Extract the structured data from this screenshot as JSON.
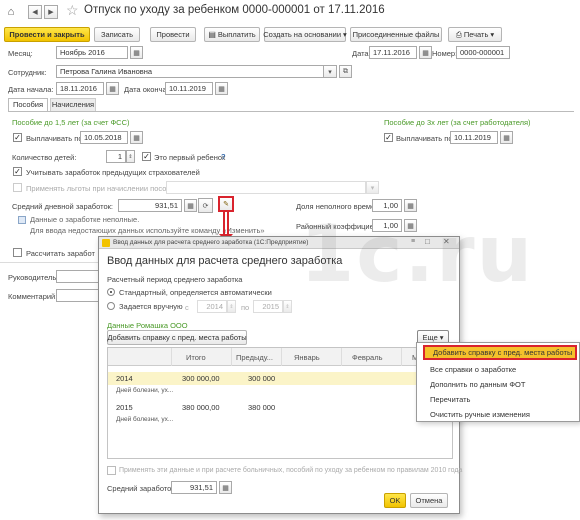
{
  "window": {
    "title": "Отпуск по уходу за ребенком 0000-000001 от 17.11.2016"
  },
  "toolbar": {
    "post_close": "Провести и закрыть",
    "save": "Записать",
    "post": "Провести",
    "pay": "Выплатить",
    "create_based": "Создать на основании",
    "attached_files": "Присоединенные файлы",
    "print": "Печать"
  },
  "header": {
    "month_label": "Месяц:",
    "month_value": "Ноябрь 2016",
    "date_label": "Дата:",
    "date_value": "17.11.2016",
    "number_label": "Номер:",
    "number_value": "0000-000001",
    "employee_label": "Сотрудник:",
    "employee_value": "Петрова Галина Ивановна",
    "start_label": "Дата начала:",
    "start_value": "18.11.2016",
    "end_label": "Дата окончания:",
    "end_value": "10.11.2019"
  },
  "tabs": [
    "Пособия",
    "Начисления"
  ],
  "benefits": {
    "under15_title": "Пособие до 1,5 лет (за счет ФСС)",
    "under3_title": "Пособие до 3х лет (за счет работодателя)",
    "pay_until_label": "Выплачивать по",
    "pay_until_value": "10.05.2018",
    "pay_until3_label": "Выплачивать по",
    "pay_until3_value": "10.11.2019",
    "children_label": "Количество детей:",
    "children_value": "1",
    "first_child_label": "Это первый ребенок",
    "first_child_help": "?",
    "prev_insurers_label": "Учитывать заработок предыдущих страхователей",
    "privileges_label": "Применять льготы при начислении пособия",
    "avg_earnings_label": "Средний дневной заработок:",
    "avg_earnings_value": "931,51",
    "parttime_label": "Доля неполного времени:",
    "parttime_value": "1,00",
    "regional_label": "Районный коэффициент:",
    "regional_value": "1,00",
    "warning_line1": "Данные о заработке неполные.",
    "warning_line2": "Для ввода недостающих данных используйте команду «Изменить»",
    "calc_leave_label": "Рассчитать заработ",
    "manager_label": "Руководитель:",
    "comment_label": "Комментарий:"
  },
  "dialog": {
    "window_title": "Ввод данных для расчета среднего заработка  (1С:Предприятие)",
    "heading": "Ввод данных для расчета среднего заработка",
    "period_label": "Расчетный период среднего заработка",
    "standard_label": "Стандартный, определяется автоматически",
    "manual_label": "Задается вручную",
    "from_label": "с",
    "from_value": "2014",
    "to_label": "по",
    "to_value": "2015",
    "company_label": "Данные Ромашка ООО",
    "add_certificate": "Добавить справку с пред. места работы",
    "more": "Еще",
    "columns": [
      "",
      "Итого",
      "Предыду...",
      "Январь",
      "Февраль",
      "Ма"
    ],
    "rows": [
      {
        "year": "2014",
        "total": "300 000,00",
        "prev": "300 000",
        "sub": "Дней болезни, ух..."
      },
      {
        "year": "2015",
        "total": "380 000,00",
        "prev": "380 000",
        "sub": "Дней болезни, ух..."
      }
    ],
    "apply_label": "Применять эти данные и при расчете больничных, пособий по уходу за ребенком по правилам 2010 года",
    "avg_label": "Средний заработок:",
    "avg_value": "931,51",
    "ok": "OK",
    "cancel": "Отмена"
  },
  "context_menu": {
    "items": [
      "Добавить справку с пред. места работы",
      "Все справки о заработке",
      "Дополнить по данным ФОТ",
      "Перечитать",
      "Очистить ручные изменения"
    ]
  },
  "watermark": "1c.ru",
  "colors": {
    "accent_yellow": "#f2c300",
    "highlight_row": "#fbf4c8",
    "green_text": "#4a9a28",
    "callout_red": "#d9232d"
  }
}
